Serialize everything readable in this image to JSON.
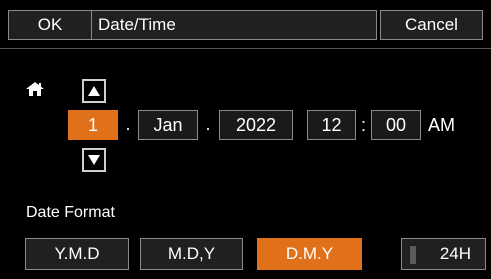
{
  "header": {
    "ok_label": "OK",
    "title": "Date/Time",
    "cancel_label": "Cancel"
  },
  "date": {
    "day": "1",
    "month": "Jan",
    "year": "2022",
    "hour": "12",
    "minute": "00",
    "ampm": "AM",
    "separator": ".",
    "time_separator": ":"
  },
  "date_format": {
    "label": "Date Format",
    "options": [
      "Y.M.D",
      "M.D,Y",
      "D.M.Y"
    ],
    "selected": "D.M.Y",
    "clock_toggle_label": "24H"
  },
  "icons": {
    "home": "home-icon",
    "up": "up-arrow-icon",
    "down": "down-arrow-icon"
  },
  "colors": {
    "accent": "#e0701a",
    "background": "#000000",
    "button": "#202020",
    "border": "#8a8a8a"
  }
}
